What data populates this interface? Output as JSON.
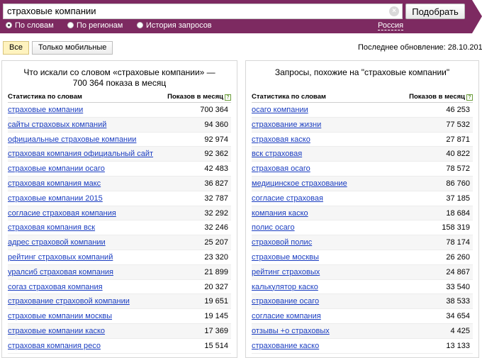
{
  "search": {
    "query": "страховые компании",
    "submit_label": "Подобрать"
  },
  "modes": [
    {
      "label": "По словам",
      "selected": true
    },
    {
      "label": "По регионам",
      "selected": false
    },
    {
      "label": "История запросов",
      "selected": false
    }
  ],
  "region": "Россия",
  "filter": {
    "all_label": "Все",
    "mobile_label": "Только мобильные"
  },
  "last_update": "Последнее обновление: 28.10.2015",
  "left_panel": {
    "title": "Что искали со словом «страховые компании» — 700 364 показа в месяц",
    "col_keyword": "Статистика по словам",
    "col_count": "Показов в месяц",
    "rows": [
      {
        "keyword": "страховые компании",
        "count": "700 364"
      },
      {
        "keyword": "сайты страховых компаний",
        "count": "94 360"
      },
      {
        "keyword": "официальные страховые компании",
        "count": "92 974"
      },
      {
        "keyword": "страховая компания официальный сайт",
        "count": "92 362"
      },
      {
        "keyword": "страховые компании осаго",
        "count": "42 483"
      },
      {
        "keyword": "страховая компания макс",
        "count": "36 827"
      },
      {
        "keyword": "страховые компании 2015",
        "count": "32 787"
      },
      {
        "keyword": "согласие страховая компания",
        "count": "32 292"
      },
      {
        "keyword": "страховая компания вск",
        "count": "32 246"
      },
      {
        "keyword": "адрес страховой компании",
        "count": "25 207"
      },
      {
        "keyword": "рейтинг страховых компаний",
        "count": "23 320"
      },
      {
        "keyword": "уралсиб страховая компания",
        "count": "21 899"
      },
      {
        "keyword": "согаз страховая компания",
        "count": "20 327"
      },
      {
        "keyword": "страхование страховой компании",
        "count": "19 651"
      },
      {
        "keyword": "страховые компании москвы",
        "count": "19 145"
      },
      {
        "keyword": "страховые компании каско",
        "count": "17 369"
      },
      {
        "keyword": "страховая компания ресо",
        "count": "15 514"
      }
    ]
  },
  "right_panel": {
    "title": "Запросы, похожие на \"страховые компании\"",
    "col_keyword": "Статистика по словам",
    "col_count": "Показов в месяц",
    "rows": [
      {
        "keyword": "осаго компании",
        "count": "46 253"
      },
      {
        "keyword": "страхование жизни",
        "count": "77 532"
      },
      {
        "keyword": "страховая каско",
        "count": "27 871"
      },
      {
        "keyword": "вск страховая",
        "count": "40 822"
      },
      {
        "keyword": "страховая осаго",
        "count": "78 572"
      },
      {
        "keyword": "медицинское страхование",
        "count": "86 760"
      },
      {
        "keyword": "согласие страховая",
        "count": "37 185"
      },
      {
        "keyword": "компания каско",
        "count": "18 684"
      },
      {
        "keyword": "полис осаго",
        "count": "158 319"
      },
      {
        "keyword": "страховой полис",
        "count": "78 174"
      },
      {
        "keyword": "страховые москвы",
        "count": "26 260"
      },
      {
        "keyword": "рейтинг страховых",
        "count": "24 867"
      },
      {
        "keyword": "калькулятор каско",
        "count": "33 540"
      },
      {
        "keyword": "страхование осаго",
        "count": "38 533"
      },
      {
        "keyword": "согласие компания",
        "count": "34 654"
      },
      {
        "keyword": "отзывы +о страховых",
        "count": "4 425"
      },
      {
        "keyword": "страхование каско",
        "count": "13 133"
      }
    ]
  }
}
